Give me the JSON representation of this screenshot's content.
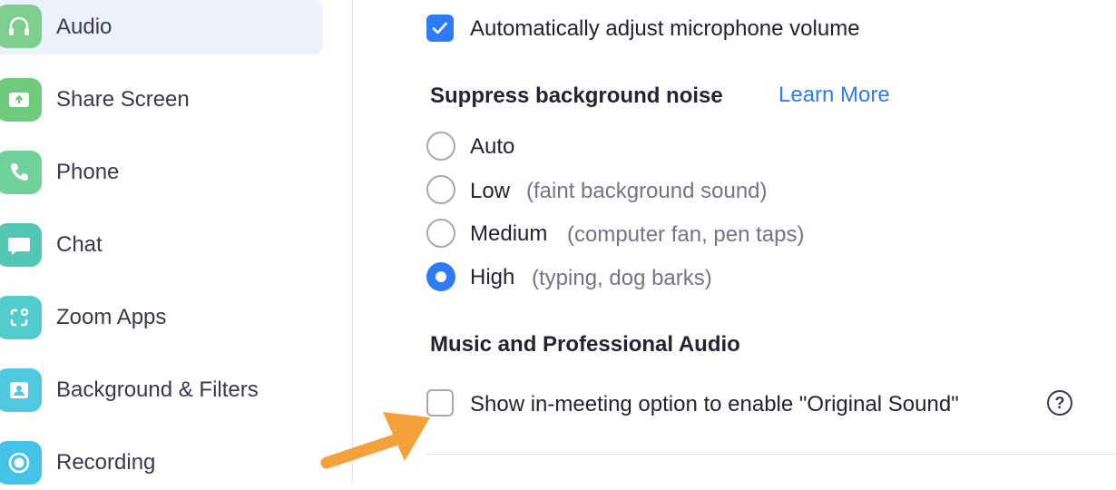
{
  "sidebar": {
    "items": [
      {
        "label": "Audio",
        "icon": "headphones-icon",
        "color": "#7ecf8d",
        "active": true
      },
      {
        "label": "Share Screen",
        "icon": "share-screen-icon",
        "color": "#6fcb7b"
      },
      {
        "label": "Phone",
        "icon": "phone-icon",
        "color": "#6fd19a"
      },
      {
        "label": "Chat",
        "icon": "chat-bubble-icon",
        "color": "#53c7b4"
      },
      {
        "label": "Zoom Apps",
        "icon": "apps-icon",
        "color": "#52cbcb"
      },
      {
        "label": "Background & Filters",
        "icon": "portrait-icon",
        "color": "#4fc8e0"
      },
      {
        "label": "Recording",
        "icon": "record-icon",
        "color": "#45c2e8"
      }
    ]
  },
  "audio": {
    "auto_adjust_label": "Automatically adjust microphone volume",
    "auto_adjust_checked": true,
    "suppress": {
      "heading": "Suppress background noise",
      "learn_more": "Learn More",
      "options": [
        {
          "label": "Auto",
          "hint": "",
          "selected": false
        },
        {
          "label": "Low",
          "hint": "(faint background sound)",
          "selected": false
        },
        {
          "label": "Medium",
          "hint": "(computer fan, pen taps)",
          "selected": false
        },
        {
          "label": "High",
          "hint": "(typing, dog barks)",
          "selected": true
        }
      ]
    },
    "music": {
      "heading": "Music and Professional Audio",
      "original_sound_label": "Show in-meeting option to enable \"Original Sound\"",
      "original_sound_checked": false,
      "help_glyph": "?"
    }
  },
  "colors": {
    "accent": "#2d7cf6",
    "annotation_arrow": "#f5a13a"
  }
}
